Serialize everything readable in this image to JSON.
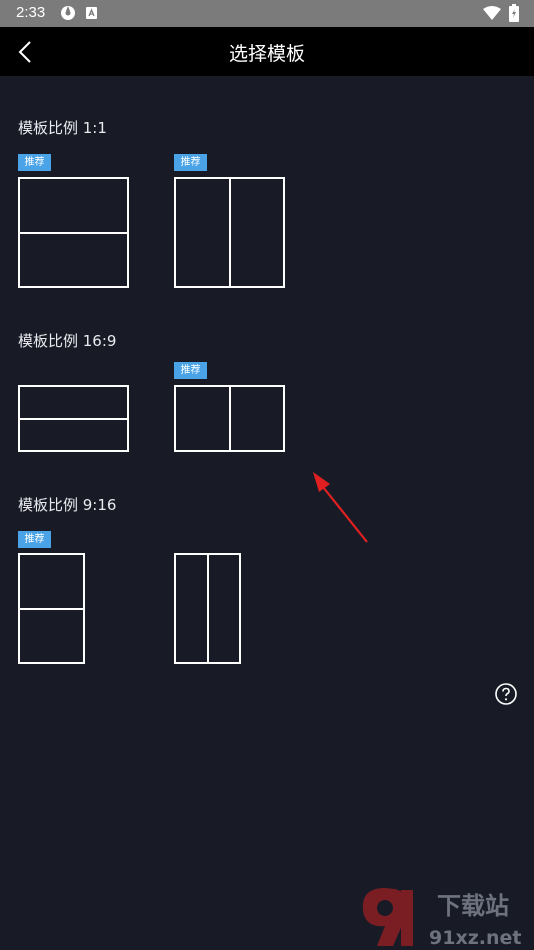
{
  "status_bar": {
    "time": "2:33"
  },
  "header": {
    "title": "选择模板"
  },
  "sections": [
    {
      "label": "模板比例 1:1",
      "badges": [
        "推荐",
        "推荐"
      ]
    },
    {
      "label": "模板比例 16:9",
      "badges": [
        "推荐"
      ]
    },
    {
      "label": "模板比例 9:16",
      "badges": [
        "推荐"
      ]
    }
  ],
  "watermark": {
    "top_text": "下载站",
    "bottom_text": "91xz.net"
  },
  "colors": {
    "background": "#181b26",
    "appbar": "#000000",
    "badge": "#4aa3e6",
    "arrow": "#e02020"
  }
}
